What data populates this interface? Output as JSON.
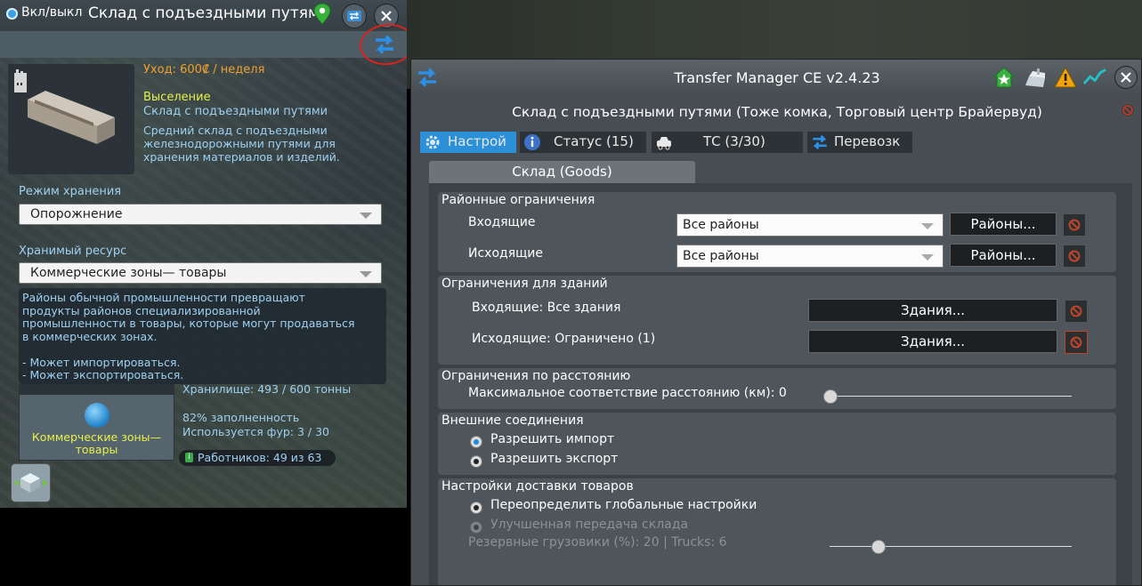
{
  "info_panel": {
    "toggle_label": "Вкл/выкл",
    "title": "Склад с подъездными путями",
    "upkeep": "Уход: 600₡ / неделя",
    "evict": "Выселение",
    "building_name": "Склад с подъездными путями",
    "building_desc": "Средний склад с подъездными железнодорожными путями для хранения материалов и изделий.",
    "storage_mode_label": "Режим хранения",
    "storage_mode_value": "Опорожнение",
    "resource_label": "Хранимый ресурс",
    "resource_value": "Коммерческие зоны— товары",
    "resource_desc_lines": [
      "Районы обычной промышленности превращают",
      "продукты районов специализированной",
      "промышленности в товары, которые могут продаваться",
      "в коммерческих зонах.",
      "",
      "- Может импортироваться.",
      "- Может экспортироваться."
    ],
    "resource_tile_label": "Коммерческие зоны— товары",
    "storage": "Хранилище: 493 / 600 тонны",
    "fill": "82% заполненность",
    "trucks": "Используется фур: 3 / 30",
    "workers": "Работников: 49 из 63",
    "workers_icon": "i"
  },
  "transfer_manager": {
    "title": "Transfer Manager CE v2.4.23",
    "building_header": "Склад с подъездными путями (Тоже комка, Торговый центр Брайервуд)",
    "tabs": [
      {
        "label": "Настрой"
      },
      {
        "label": "Статус (15)"
      },
      {
        "label": "ТС (3/30)"
      },
      {
        "label": "Перевозк"
      }
    ],
    "subtab": "Склад (Goods)",
    "district": {
      "title": "Районные ограничения",
      "incoming_label": "Входящие",
      "incoming_value": "Все районы",
      "outgoing_label": "Исходящие",
      "outgoing_value": "Все районы",
      "button": "Районы..."
    },
    "building": {
      "title": "Ограничения для зданий",
      "incoming": "Входящие: Все здания",
      "outgoing": "Исходящие: Ограничено (1)",
      "button": "Здания..."
    },
    "distance": {
      "title": "Ограничения по расстоянию",
      "label": "Максимальное соответствие расстоянию (км): 0",
      "value": 0
    },
    "outside": {
      "title": "Внешние соединения",
      "import": "Разрешить импорт",
      "export": "Разрешить экспорт",
      "import_checked": true,
      "export_checked": false
    },
    "delivery": {
      "title": "Настройки доставки товаров",
      "override": "Переопределить глобальные настройки",
      "improved": "Улучшенная передача склада",
      "reserve": "Резервные грузовики (%): 20 | Trucks: 6",
      "reserve_value": 20
    }
  },
  "colors": {
    "accent": "#2c90d8",
    "upkeep": "#f0a030",
    "highlight": "#e6f04a",
    "info_text": "#9fd0f0",
    "annotation_ring": "#d8241f"
  }
}
